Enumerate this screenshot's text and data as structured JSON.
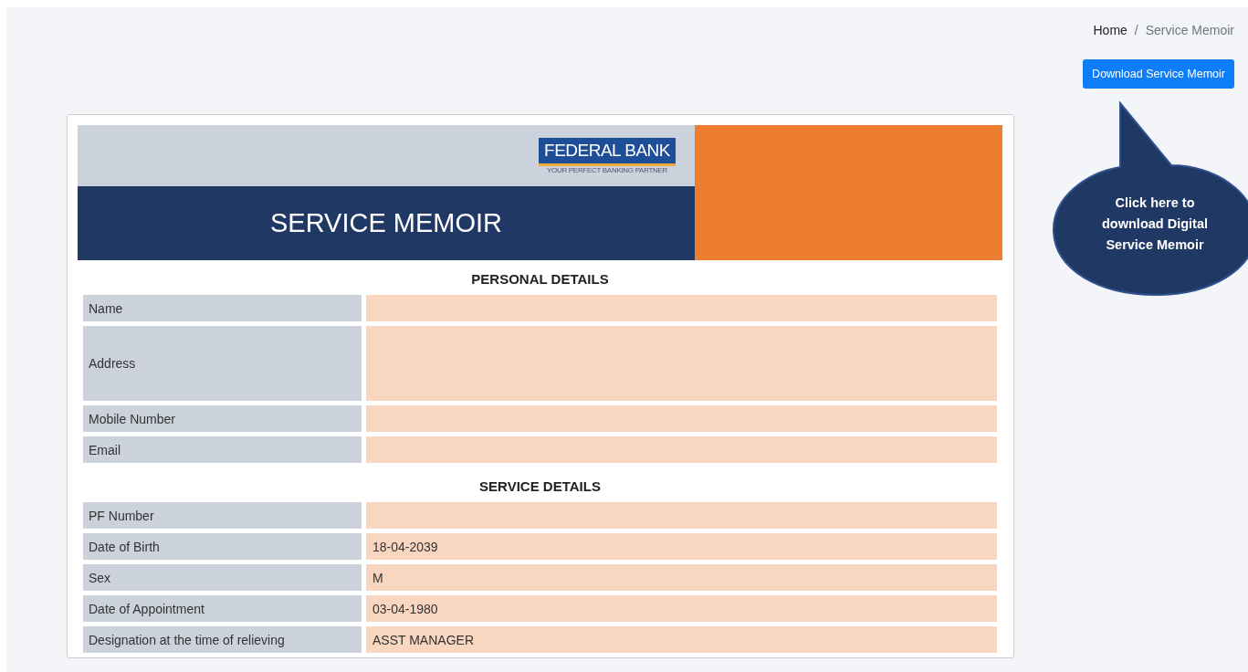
{
  "breadcrumb": [
    {
      "label": "Home",
      "selected": false
    },
    {
      "label": "Service Memoir",
      "selected": true
    }
  ],
  "breadcrumb_separator": "/",
  "download_button": "Download Service Memoir",
  "callout": "Click here to download Digital Service Memoir",
  "document": {
    "logo": {
      "name": "FEDERAL BANK",
      "tagline": "YOUR PERFECT BANKING PARTNER"
    },
    "title": "SERVICE MEMOIR",
    "sections": [
      {
        "heading": "PERSONAL DETAILS",
        "rows": [
          {
            "label": "Name",
            "value": "",
            "kind": "single"
          },
          {
            "label": "Address",
            "value": "",
            "kind": "tall"
          },
          {
            "label": "Mobile Number",
            "value": "",
            "kind": "single"
          },
          {
            "label": "Email",
            "value": "",
            "kind": "single"
          }
        ]
      },
      {
        "heading": "SERVICE DETAILS",
        "rows": [
          {
            "label": "PF Number",
            "value": "",
            "kind": "single"
          },
          {
            "label": "Date of Birth",
            "value": "18-04-2039",
            "kind": "single"
          },
          {
            "label": "Sex",
            "value": "M",
            "kind": "single"
          },
          {
            "label": "Date of Appointment",
            "value": "03-04-1980",
            "kind": "single"
          },
          {
            "label": "Designation at the time of relieving",
            "value": "ASST MANAGER",
            "kind": "single"
          }
        ]
      }
    ]
  }
}
